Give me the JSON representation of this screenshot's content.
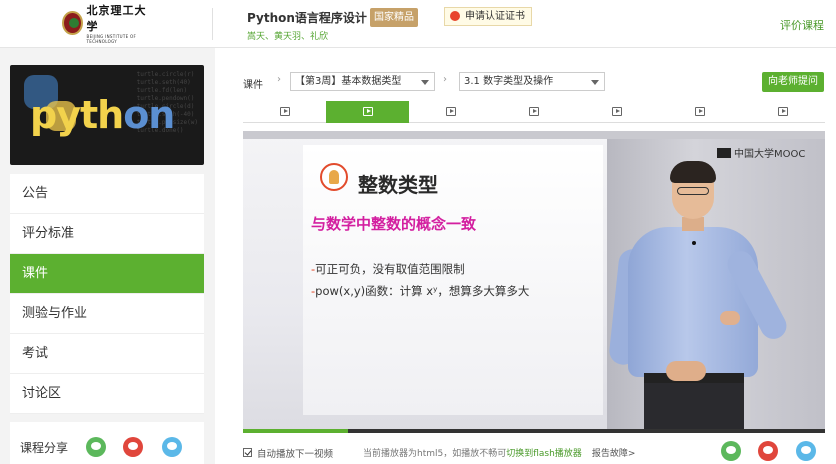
{
  "header": {
    "logo_cn": "北京理工大学",
    "logo_en": "BEIJING INSTITUTE OF TECHNOLOGY",
    "course_title": "Python语言程序设计",
    "badge": "国家精品",
    "cert_button": "申请认证证书",
    "teachers": "嵩天、黄天羽、礼欣",
    "rate_link": "评价课程"
  },
  "sidebar": {
    "banner_word_a": "pyth",
    "banner_word_b": "on",
    "menu": [
      "公告",
      "评分标准",
      "课件",
      "测验与作业",
      "考试",
      "讨论区"
    ],
    "active_index": 2,
    "share_label": "课程分享"
  },
  "breadcrumb": {
    "label": "课件",
    "week_select": "【第3周】基本数据类型",
    "lesson_select": "3.1 数字类型及操作",
    "ask_button": "向老师提问"
  },
  "tabs": {
    "count": 7,
    "active_index": 1
  },
  "video": {
    "brand": "中国大学MOOC",
    "slide_title": "整数类型",
    "slide_subtitle": "与数学中整数的概念一致",
    "bullets": [
      {
        "dash": "-",
        "text": "可正可负，没有取值范围限制"
      },
      {
        "dash": "-",
        "text": "pow(x,y)函数：计算 xʸ，想算多大算多大"
      }
    ],
    "progress_fraction": 0.18
  },
  "bottom": {
    "autoplay_label": "自动播放下一视频",
    "player_info": "当前播放器为html5，如播放不畅可",
    "switch_link": "切换到flash播放器",
    "report": "报告故障>"
  },
  "colors": {
    "accent": "#5cb030",
    "badge": "#c6a169",
    "slide_subtitle": "#d31fa0"
  }
}
